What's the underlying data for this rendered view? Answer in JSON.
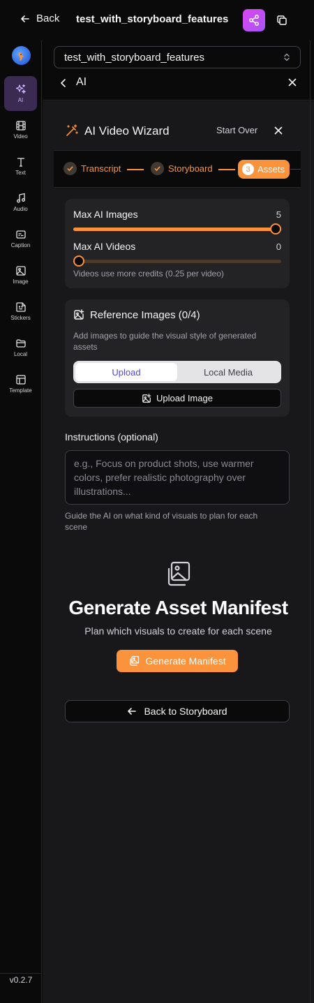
{
  "topbar": {
    "back_label": "Back",
    "project_title": "test_with_storyboard_features"
  },
  "sidebar": {
    "items": [
      {
        "label": "AI",
        "icon": "sparkles-icon"
      },
      {
        "label": "Video",
        "icon": "film-icon"
      },
      {
        "label": "Text",
        "icon": "text-icon"
      },
      {
        "label": "Audio",
        "icon": "music-icon"
      },
      {
        "label": "Caption",
        "icon": "caption-icon"
      },
      {
        "label": "Image",
        "icon": "image-icon"
      },
      {
        "label": "Stickers",
        "icon": "sticker-icon"
      },
      {
        "label": "Local",
        "icon": "folder-icon"
      },
      {
        "label": "Template",
        "icon": "template-icon"
      }
    ],
    "active_item": "AI",
    "version": "v0.2.7"
  },
  "project_select": {
    "value": "test_with_storyboard_features"
  },
  "panel": {
    "title": "AI"
  },
  "wizard": {
    "title": "AI Video Wizard",
    "start_over": "Start Over",
    "steps": [
      {
        "label": "Transcript",
        "state": "complete"
      },
      {
        "label": "Storyboard",
        "state": "complete"
      },
      {
        "label": "Assets",
        "state": "active",
        "number": "3"
      }
    ]
  },
  "sliders": {
    "max_images": {
      "label": "Max AI Images",
      "value": "5",
      "fraction": 1.0
    },
    "max_videos": {
      "label": "Max AI Videos",
      "value": "0",
      "fraction": 0.0
    },
    "note": "Videos use more credits (0.25 per video)"
  },
  "reference": {
    "title": "Reference Images (0/4)",
    "description": "Add images to guide the visual style of generated assets",
    "tabs": [
      "Upload",
      "Local Media"
    ],
    "active_tab": "Upload",
    "upload_button": "Upload Image"
  },
  "instructions": {
    "label": "Instructions (optional)",
    "placeholder": "e.g., Focus on product shots, use warmer colors, prefer realistic photography over illustrations...",
    "help": "Guide the AI on what kind of visuals to plan for each scene"
  },
  "generate": {
    "title": "Generate Asset Manifest",
    "subtitle": "Plan which visuals to create for each scene",
    "button": "Generate Manifest",
    "back_button": "Back to Storyboard"
  },
  "colors": {
    "accent": "#fb923c",
    "active_nav_bg": "#3b2a52",
    "share_gradient": [
      "#d946ef",
      "#a855f7"
    ]
  }
}
